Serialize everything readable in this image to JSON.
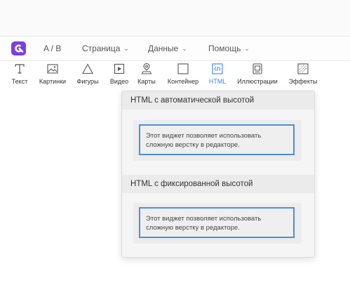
{
  "header": {
    "ab_label": "A / B",
    "menus": [
      {
        "label": "Страница"
      },
      {
        "label": "Данные"
      },
      {
        "label": "Помощь"
      }
    ]
  },
  "toolbar": {
    "tools": [
      {
        "label": "Текст",
        "icon": "text-icon"
      },
      {
        "label": "Картинки",
        "icon": "image-icon"
      },
      {
        "label": "Фигуры",
        "icon": "shapes-icon"
      },
      {
        "label": "Видео",
        "icon": "video-icon"
      },
      {
        "label": "Карты",
        "icon": "map-pin-icon"
      },
      {
        "label": "Контейнер",
        "icon": "container-icon"
      },
      {
        "label": "HTML",
        "icon": "html-code-icon"
      },
      {
        "label": "Иллюстрации",
        "icon": "illustrations-icon"
      },
      {
        "label": "Эффекты",
        "icon": "effects-icon"
      }
    ],
    "active": "HTML"
  },
  "dropdown": {
    "sections": [
      {
        "title": "HTML с автоматической высотой",
        "preview_text": "Этот виджет позволяет использовать сложную верстку в редакторе."
      },
      {
        "title": "HTML с фиксированной высотой",
        "preview_text": "Этот виджет позволяет использовать сложную верстку в редакторе."
      }
    ]
  },
  "colors": {
    "brand": "#7b3fe4",
    "accent": "#3a82f6",
    "preview_border": "#4b8fe0"
  }
}
